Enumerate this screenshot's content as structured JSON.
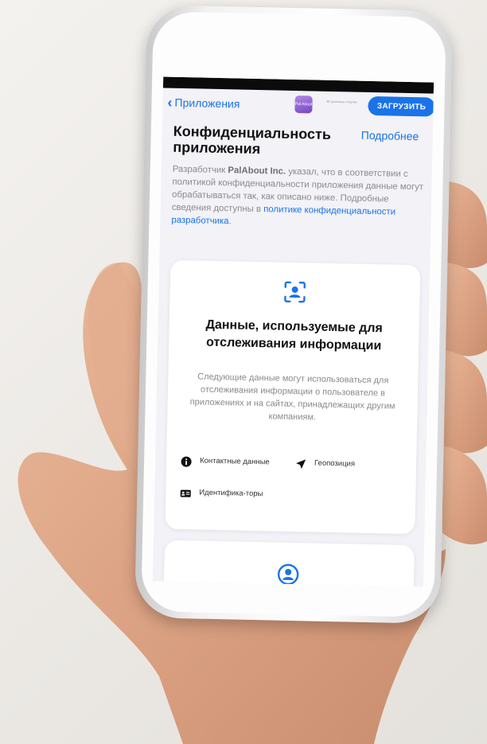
{
  "nav": {
    "back_label": "Приложения",
    "app_icon_text": "Pal About",
    "inapp_note": "Встроенные покупки",
    "get_button": "ЗАГРУЗИТЬ"
  },
  "header": {
    "title": "Конфиденциальность приложения",
    "more_link": "Подробнее"
  },
  "description": {
    "part1": "Разработчик ",
    "developer": "PalAbout Inc.",
    "part2": " указал, что в соответствии с политикой конфиденциальности приложения данные могут обрабатываться так, как описано ниже. Подробные сведения доступны в ",
    "link": "политике конфиденциальности разработчика",
    "part3": "."
  },
  "tracking_card": {
    "icon": "person-viewfinder-icon",
    "title": "Данные, используемые для отслеживания информации",
    "text": "Следующие данные могут использоваться для отслеживания информации о пользователе в приложениях и на сайтах, принадлежащих другим компаниям.",
    "items": [
      {
        "icon": "info-circle-icon",
        "label": "Контактные данные"
      },
      {
        "icon": "location-arrow-icon",
        "label": "Геопозиция"
      },
      {
        "icon": "id-card-icon",
        "label": "Идентифика-торы"
      }
    ]
  },
  "second_card": {
    "icon": "person-circle-icon"
  },
  "colors": {
    "accent": "#1a73e8",
    "icon_purple": "#8a5bd6"
  }
}
